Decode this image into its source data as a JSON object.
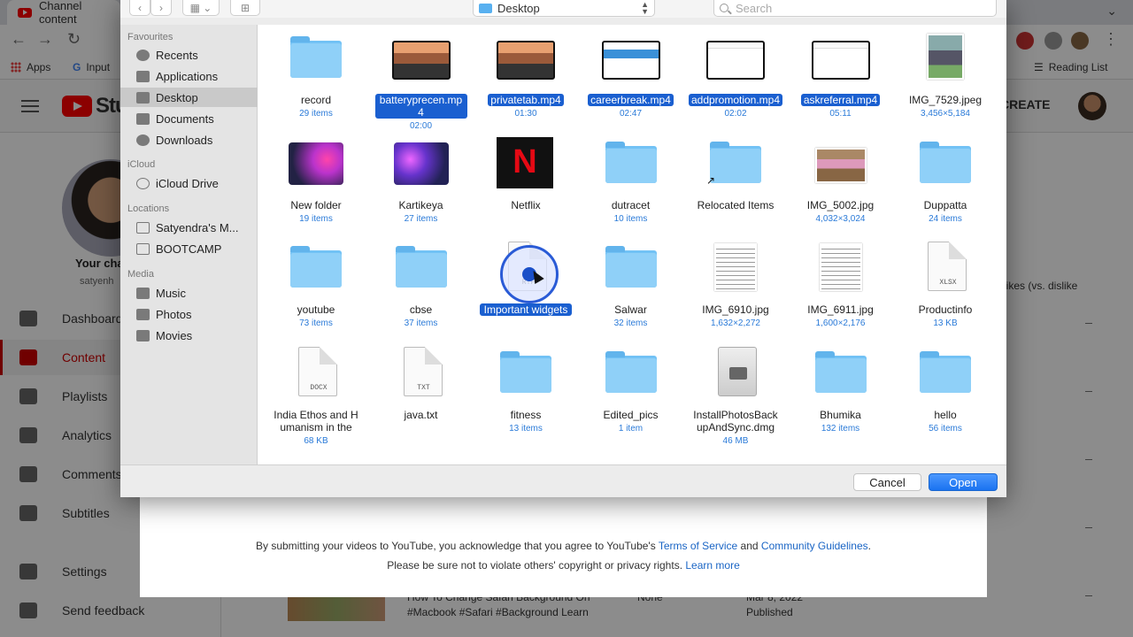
{
  "browser": {
    "tab_title": "Channel content",
    "bookmarks": {
      "apps": "Apps",
      "input": "Input",
      "reading_list": "Reading List"
    }
  },
  "youtube": {
    "logo_text": "Stu",
    "create_label": "CREATE",
    "channel": {
      "name": "Your cha",
      "handle": "satyenh"
    },
    "nav": [
      "Dashboard",
      "Content",
      "Playlists",
      "Analytics",
      "Comments",
      "Subtitles",
      "Settings",
      "Send feedback"
    ],
    "right_col_text": "Likes (vs. dislike",
    "bottom_row": {
      "title": "How To Change Safari Background On",
      "tags": "#Macbook #Safari #Background Learn",
      "date": "Mar 8, 2022",
      "status": "Published",
      "visibility": "None"
    },
    "upload_notice": {
      "line1_prefix": "By submitting your videos to YouTube, you acknowledge that you agree to YouTube's",
      "terms": "Terms of Service",
      "and": "and",
      "guidelines": "Community Guidelines",
      "period": ".",
      "line2_prefix": "Please be sure not to violate others' copyright or privacy rights.",
      "learn_more": "Learn more"
    }
  },
  "dialog": {
    "location": "Desktop",
    "search_placeholder": "Search",
    "sidebar": {
      "favourites_label": "Favourites",
      "favourites": [
        "Recents",
        "Applications",
        "Desktop",
        "Documents",
        "Downloads"
      ],
      "icloud_label": "iCloud",
      "icloud": [
        "iCloud Drive"
      ],
      "locations_label": "Locations",
      "locations": [
        "Satyendra's M...",
        "BOOTCAMP"
      ],
      "media_label": "Media",
      "media": [
        "Music",
        "Photos",
        "Movies"
      ],
      "selected": "Desktop"
    },
    "files": [
      {
        "name": "record",
        "meta": "29 items",
        "kind": "folder"
      },
      {
        "name": "batteryprecen.mp4",
        "meta": "02:00",
        "kind": "video-desk",
        "selected": true
      },
      {
        "name": "privatetab.mp4",
        "meta": "01:30",
        "kind": "video-desk",
        "selected": true
      },
      {
        "name": "careerbreak.mp4",
        "meta": "02:47",
        "kind": "video-screen",
        "selected": true
      },
      {
        "name": "addpromotion.mp4",
        "meta": "02:02",
        "kind": "video-white",
        "selected": true
      },
      {
        "name": "askreferral.mp4",
        "meta": "05:11",
        "kind": "video-white",
        "selected": true
      },
      {
        "name": "IMG_7529.jpeg",
        "meta": "3,456×5,184",
        "kind": "photo"
      },
      {
        "name": "New folder",
        "meta": "19 items",
        "kind": "galaxy2"
      },
      {
        "name": "Kartikeya",
        "meta": "27 items",
        "kind": "galaxy"
      },
      {
        "name": "Netflix",
        "meta": "",
        "kind": "netflix"
      },
      {
        "name": "dutracet",
        "meta": "10 items",
        "kind": "folder"
      },
      {
        "name": "Relocated Items",
        "meta": "",
        "kind": "folder-alias"
      },
      {
        "name": "IMG_5002.jpg",
        "meta": "4,032×3,024",
        "kind": "photo-card"
      },
      {
        "name": "Duppatta",
        "meta": "24 items",
        "kind": "folder"
      },
      {
        "name": "youtube",
        "meta": "73 items",
        "kind": "folder"
      },
      {
        "name": "cbse",
        "meta": "37 items",
        "kind": "folder"
      },
      {
        "name": "Important widgets",
        "meta": "",
        "kind": "doc",
        "ext": "RTF",
        "selected": true
      },
      {
        "name": "Salwar",
        "meta": "32 items",
        "kind": "folder"
      },
      {
        "name": "IMG_6910.jpg",
        "meta": "1,632×2,272",
        "kind": "photo-doc"
      },
      {
        "name": "IMG_6911.jpg",
        "meta": "1,600×2,176",
        "kind": "photo-doc"
      },
      {
        "name": "Productinfo",
        "meta": "13 KB",
        "kind": "doc",
        "ext": "XLSX"
      },
      {
        "name": "India Ethos and Humanism in the",
        "meta": "68 KB",
        "kind": "doc",
        "ext": "DOCX"
      },
      {
        "name": "java.txt",
        "meta": "",
        "kind": "doc",
        "ext": "TXT"
      },
      {
        "name": "fitness",
        "meta": "13 items",
        "kind": "folder"
      },
      {
        "name": "Edited_pics",
        "meta": "1 item",
        "kind": "folder"
      },
      {
        "name": "InstallPhotosBackupAndSync.dmg",
        "meta": "46 MB",
        "kind": "dmg"
      },
      {
        "name": "Bhumika",
        "meta": "132 items",
        "kind": "folder"
      },
      {
        "name": "hello",
        "meta": "56 items",
        "kind": "folder"
      }
    ],
    "buttons": {
      "cancel": "Cancel",
      "open": "Open"
    }
  },
  "colors": {
    "accent": "#1a5fd0",
    "meta_blue": "#2a7ad8",
    "folder": "#72c2f5",
    "yt_red": "#ff0000"
  }
}
